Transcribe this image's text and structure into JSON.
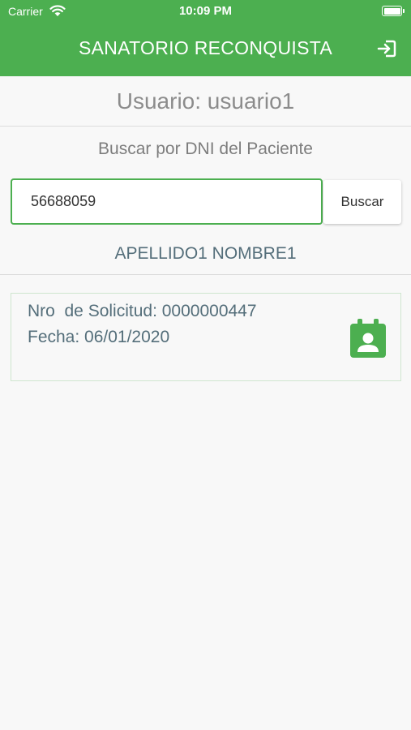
{
  "status_bar": {
    "carrier": "Carrier",
    "time": "10:09 PM"
  },
  "header": {
    "title": "SANATORIO RECONQUISTA",
    "logout_icon": "logout-icon"
  },
  "user": {
    "label": "Usuario: usuario1"
  },
  "search": {
    "prompt": "Buscar por DNI del Paciente",
    "value": "56688059",
    "button_label": "Buscar"
  },
  "patient": {
    "name": "APELLIDO1 NOMBRE1"
  },
  "requests": [
    {
      "number_line": "Nro  de Solicitud: 0000000447",
      "date_line": "Fecha: 06/01/2020",
      "icon": "calendar-person-icon"
    }
  ],
  "colors": {
    "accent": "#4caf50",
    "text_blue_gray": "#546e7a",
    "text_gray": "#8c8c8c",
    "background": "#f8f8f8"
  }
}
